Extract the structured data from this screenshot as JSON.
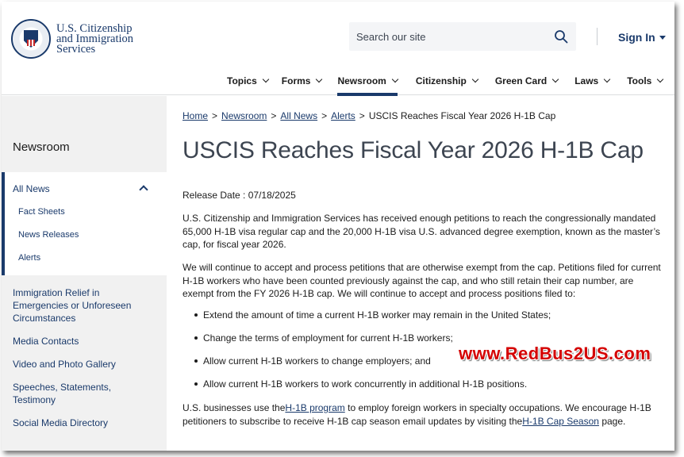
{
  "header": {
    "logo": {
      "line1": "U.S. Citizenship",
      "line2": "and Immigration",
      "line3": "Services"
    },
    "search_placeholder": "Search our site",
    "sign_in_label": "Sign In",
    "nav": [
      {
        "label": "Topics",
        "active": false
      },
      {
        "label": "Forms",
        "active": false
      },
      {
        "label": "Newsroom",
        "active": true
      },
      {
        "label": "Citizenship",
        "active": false
      },
      {
        "label": "Green Card",
        "active": false
      },
      {
        "label": "Laws",
        "active": false
      },
      {
        "label": "Tools",
        "active": false
      }
    ],
    "colors": {
      "brand": "#1a3a6b",
      "sidebar_bg": "#f1f1f1",
      "watermark": "#d40000"
    }
  },
  "sidebar": {
    "title": "Newsroom",
    "active_section": "All News",
    "sub_items": [
      "Fact Sheets",
      "News Releases",
      "Alerts"
    ],
    "links": [
      "Immigration Relief in Emergencies or Unforeseen Circumstances",
      "Media Contacts",
      "Video and Photo Gallery",
      "Speeches, Statements, Testimony",
      "Social Media Directory"
    ]
  },
  "breadcrumb": {
    "items": [
      "Home",
      "Newsroom",
      "All News",
      "Alerts"
    ],
    "separator": ">",
    "current": "USCIS Reaches Fiscal Year 2026 H-1B Cap"
  },
  "article": {
    "title": "USCIS Reaches Fiscal Year 2026 H-1B Cap",
    "release_label": "Release Date :",
    "release_date": "07/18/2025",
    "para1": "U.S. Citizenship and Immigration Services has received enough petitions to reach the congressionally mandated 65,000 H-1B visa regular cap and the 20,000 H-1B visa U.S. advanced degree exemption, known as the master’s cap, for fiscal year 2026.",
    "para2": "We will continue to accept and process petitions that are otherwise exempt from the cap. Petitions filed for current H-1B workers who have been counted previously against the cap, and who still retain their cap number, are exempt from the FY 2026 H-1B cap. We will continue to accept and process positions filed to:",
    "bullets": [
      "Extend the amount of time a current H-1B worker may remain in the United States;",
      "Change the terms of employment for current H-1B workers;",
      "Allow current H-1B workers to change employers; and",
      "Allow current H-1B workers to work concurrently in additional H-1B positions."
    ],
    "para3": {
      "part1": "U.S. businesses use the",
      "link1": "H-1B program",
      "part2": "to employ foreign workers in specialty occupations. We encourage H-1B petitioners to subscribe to receive H-1B cap season email updates by visiting the",
      "link2": "H-1B Cap Season",
      "part3": "page."
    }
  },
  "watermark": "www.RedBus2US.com"
}
